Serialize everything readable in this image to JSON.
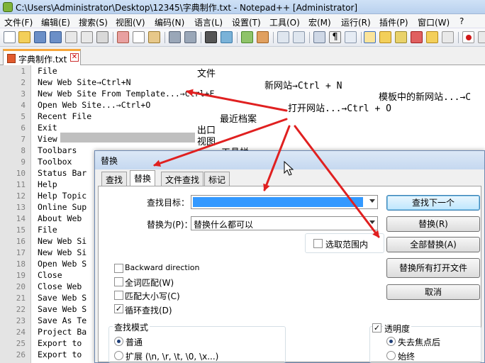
{
  "window": {
    "title": "C:\\Users\\Administrator\\Desktop\\12345\\字典制作.txt - Notepad++ [Administrator]"
  },
  "menu": [
    "文件(F)",
    "编辑(E)",
    "搜索(S)",
    "视图(V)",
    "编码(N)",
    "语言(L)",
    "设置(T)",
    "工具(O)",
    "宏(M)",
    "运行(R)",
    "插件(P)",
    "窗口(W)",
    "?"
  ],
  "tab": {
    "label": "字典制作.txt"
  },
  "lines": [
    {
      "n": "1",
      "text": "File"
    },
    {
      "n": "2",
      "text": "New Web Site→Ctrl+N"
    },
    {
      "n": "3",
      "text": "New Web Site From Template...→Ctrl+F"
    },
    {
      "n": "4",
      "text": "Open Web Site...→Ctrl+O"
    },
    {
      "n": "5",
      "text": "Recent File"
    },
    {
      "n": "6",
      "text": "Exit"
    },
    {
      "n": "7",
      "text": "View"
    },
    {
      "n": "8",
      "text": "Toolbars"
    },
    {
      "n": "9",
      "text": "Toolbox"
    },
    {
      "n": "10",
      "text": "Status Bar"
    },
    {
      "n": "11",
      "text": "Help"
    },
    {
      "n": "12",
      "text": "Help Topic"
    },
    {
      "n": "13",
      "text": "Online Sup"
    },
    {
      "n": "14",
      "text": "About Web"
    },
    {
      "n": "15",
      "text": "File"
    },
    {
      "n": "16",
      "text": "New Web Si"
    },
    {
      "n": "17",
      "text": "New Web Si"
    },
    {
      "n": "18",
      "text": "Open Web S"
    },
    {
      "n": "19",
      "text": "Close"
    },
    {
      "n": "20",
      "text": "Close Web"
    },
    {
      "n": "21",
      "text": "Save Web S"
    },
    {
      "n": "22",
      "text": "Save Web S"
    },
    {
      "n": "23",
      "text": "Save As Te"
    },
    {
      "n": "24",
      "text": "Project Ba"
    },
    {
      "n": "25",
      "text": "Export to"
    },
    {
      "n": "26",
      "text": "Export to"
    }
  ],
  "annotations": {
    "a1": "文件",
    "a2": "新网站→Ctrl + N",
    "a3": "模板中的新网站...→C",
    "a4": "打开网站...→Ctrl + O",
    "a5": "最近档案",
    "a6": "出口",
    "a7": "视图",
    "a8": "工具栏"
  },
  "dialog": {
    "title": "替换",
    "tabs": [
      "查找",
      "替换",
      "文件查找",
      "标记"
    ],
    "find_label": "查找目标：",
    "find_value": "",
    "replace_label": "替换为(P)：",
    "replace_value": "替换什么都可以",
    "in_selection": "选取范围内",
    "buttons": {
      "find_next": "查找下一个",
      "replace": "替换(R)",
      "replace_all": "全部替换(A)",
      "replace_all_open": "替换所有打开文件",
      "cancel": "取消"
    },
    "options": {
      "backward": "Backward direction",
      "whole_word": "全词匹配(W)",
      "match_case": "匹配大小写(C)",
      "wrap": "循环查找(D)"
    },
    "search_mode": {
      "title": "查找模式",
      "normal": "普通",
      "extended": "扩展 (\\n, \\r, \\t, \\0, \\x...)"
    },
    "transparency": {
      "title": "透明度",
      "on_lose_focus": "失去焦点后",
      "always": "始终"
    }
  },
  "colors": {
    "arrow": "#e02020",
    "selection": "#3399ff"
  }
}
